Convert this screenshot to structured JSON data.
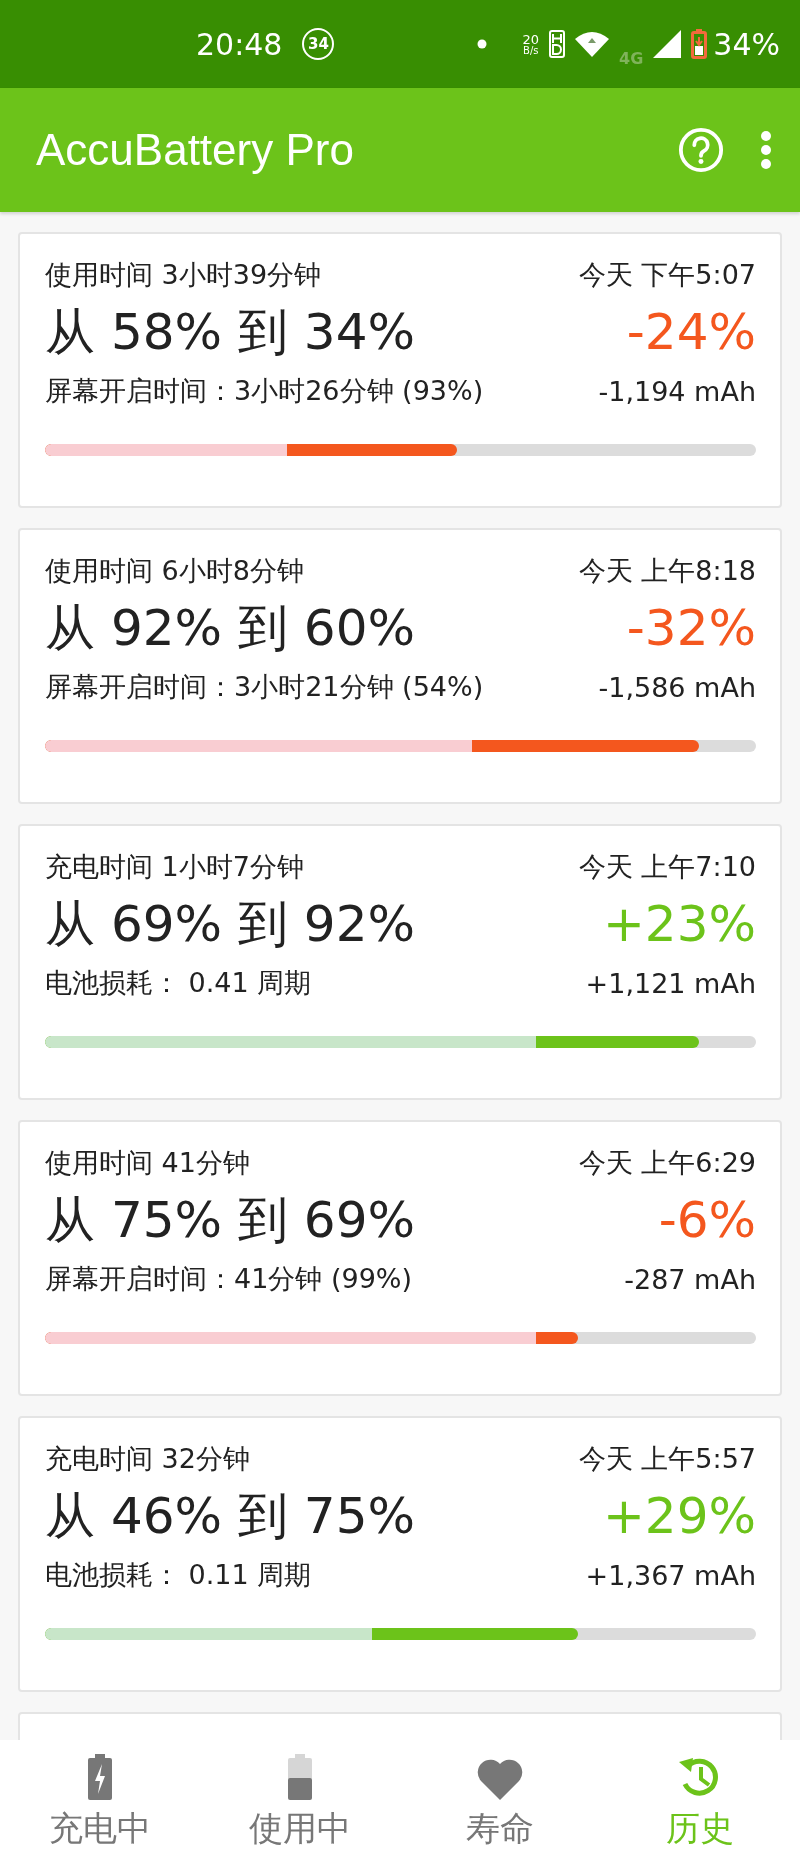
{
  "status_bar": {
    "time": "20:48",
    "notification_count": "34",
    "net_speed_value": "20",
    "net_speed_unit": "B/s",
    "network_type": "4G",
    "battery": "34%"
  },
  "app_bar": {
    "title": "AccuBattery Pro"
  },
  "sessions": [
    {
      "kind": "discharge",
      "duration": "使用时间 3小时39分钟",
      "time": "今天 下午5:07",
      "range": "从 58% 到 34%",
      "change": "-24%",
      "detail": "屏幕开启时间：3小时26分钟 (93%)",
      "capacity": "-1,194 mAh",
      "bar": {
        "fill": {
          "level": 0.58
        },
        "tint": {
          "level": 0.34
        }
      }
    },
    {
      "kind": "discharge",
      "duration": "使用时间 6小时8分钟",
      "time": "今天 上午8:18",
      "range": "从 92% 到 60%",
      "change": "-32%",
      "detail": "屏幕开启时间：3小时21分钟 (54%)",
      "capacity": "-1,586 mAh",
      "bar": {
        "fill": {
          "level": 0.92
        },
        "tint": {
          "level": 0.6
        }
      }
    },
    {
      "kind": "charge",
      "duration": "充电时间 1小时7分钟",
      "time": "今天 上午7:10",
      "range": "从 69% 到 92%",
      "change": "+23%",
      "detail": "电池损耗： 0.41 周期",
      "capacity": "+1,121 mAh",
      "bar": {
        "fill": {
          "level": 0.92
        },
        "tint": {
          "level": 0.69
        }
      }
    },
    {
      "kind": "discharge",
      "duration": "使用时间 41分钟",
      "time": "今天 上午6:29",
      "range": "从 75% 到 69%",
      "change": "-6%",
      "detail": "屏幕开启时间：41分钟 (99%)",
      "capacity": "-287 mAh",
      "bar": {
        "fill": {
          "level": 0.75
        },
        "tint": {
          "level": 0.69
        }
      }
    },
    {
      "kind": "charge",
      "duration": "充电时间 32分钟",
      "time": "今天 上午5:57",
      "range": "从 46% 到 75%",
      "change": "+29%",
      "detail": "电池损耗： 0.11 周期",
      "capacity": "+1,367 mAh",
      "bar": {
        "fill": {
          "level": 0.75
        },
        "tint": {
          "level": 0.46
        }
      }
    }
  ],
  "bottom_nav": [
    {
      "kind": "charging",
      "label": "充电中",
      "selected": false
    },
    {
      "kind": "discharging",
      "label": "使用中",
      "selected": false
    },
    {
      "kind": "health",
      "label": "寿命",
      "selected": false
    },
    {
      "kind": "history",
      "label": "历史",
      "selected": true
    }
  ]
}
